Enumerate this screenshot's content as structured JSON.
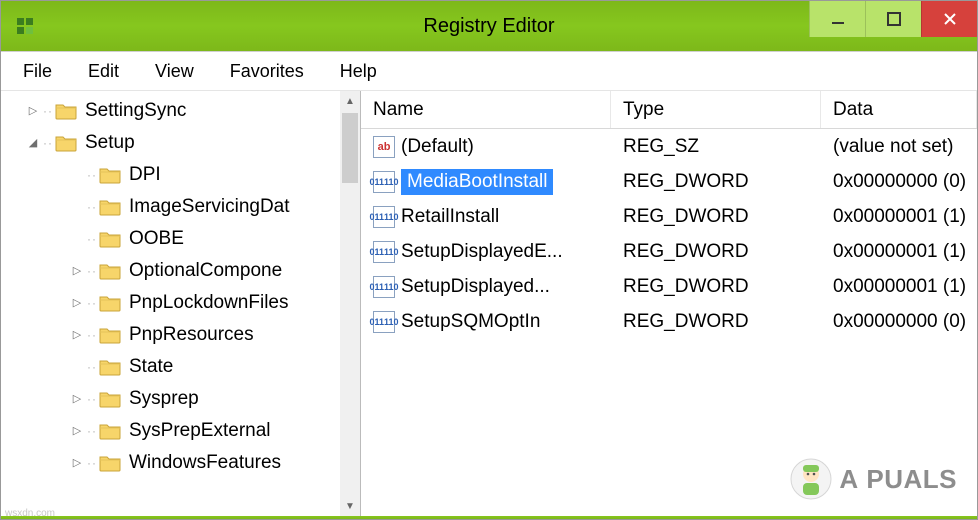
{
  "window": {
    "title": "Registry Editor"
  },
  "menu": {
    "items": [
      "File",
      "Edit",
      "View",
      "Favorites",
      "Help"
    ]
  },
  "tree": {
    "items": [
      {
        "label": "SettingSync",
        "depth": 0,
        "expander": "closed"
      },
      {
        "label": "Setup",
        "depth": 0,
        "expander": "open"
      },
      {
        "label": "DPI",
        "depth": 1,
        "expander": "none"
      },
      {
        "label": "ImageServicingDat",
        "depth": 1,
        "expander": "none"
      },
      {
        "label": "OOBE",
        "depth": 1,
        "expander": "none"
      },
      {
        "label": "OptionalCompone",
        "depth": 1,
        "expander": "closed"
      },
      {
        "label": "PnpLockdownFiles",
        "depth": 1,
        "expander": "closed"
      },
      {
        "label": "PnpResources",
        "depth": 1,
        "expander": "closed"
      },
      {
        "label": "State",
        "depth": 1,
        "expander": "none"
      },
      {
        "label": "Sysprep",
        "depth": 1,
        "expander": "closed"
      },
      {
        "label": "SysPrepExternal",
        "depth": 1,
        "expander": "closed"
      },
      {
        "label": "WindowsFeatures",
        "depth": 1,
        "expander": "closed"
      }
    ]
  },
  "list": {
    "columns": {
      "name": "Name",
      "type": "Type",
      "data": "Data"
    },
    "rows": [
      {
        "icon": "sz",
        "name": "(Default)",
        "type": "REG_SZ",
        "data": "(value not set)",
        "selected": false
      },
      {
        "icon": "dw",
        "name": "MediaBootInstall",
        "type": "REG_DWORD",
        "data": "0x00000000 (0)",
        "selected": true
      },
      {
        "icon": "dw",
        "name": "RetailInstall",
        "type": "REG_DWORD",
        "data": "0x00000001 (1)",
        "selected": false
      },
      {
        "icon": "dw",
        "name": "SetupDisplayedE...",
        "type": "REG_DWORD",
        "data": "0x00000001 (1)",
        "selected": false
      },
      {
        "icon": "dw",
        "name": "SetupDisplayed...",
        "type": "REG_DWORD",
        "data": "0x00000001 (1)",
        "selected": false
      },
      {
        "icon": "dw",
        "name": "SetupSQMOptIn",
        "type": "REG_DWORD",
        "data": "0x00000000 (0)",
        "selected": false
      }
    ]
  },
  "watermark": {
    "text_left": "A",
    "text_right": "PUALS"
  },
  "attribution": "wsxdn.com"
}
